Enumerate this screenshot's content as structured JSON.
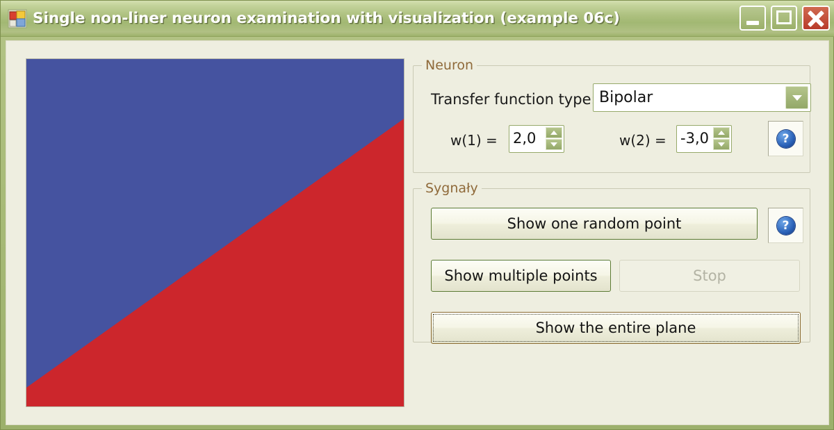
{
  "window": {
    "title": "Single non-liner neuron examination with visualization (example 06c)",
    "app_icon": "form-icon",
    "controls": {
      "minimize_label": "Minimize",
      "maximize_label": "Maximize",
      "close_label": "Close"
    }
  },
  "colors": {
    "titlebar": "#a8bb78",
    "client": "#eeeee0",
    "group_label": "#8f6a3a",
    "plot_blue": "#4553a0",
    "plot_red": "#cc262c",
    "button_border": "#5b7a33",
    "focus_border": "#8a6a30",
    "help_icon": "#2a62b8"
  },
  "plot": {
    "name": "decision-plane-visualization",
    "blue_color": "#4553a0",
    "red_color": "#cc262c",
    "boundary": {
      "left_y_fraction": 0.946,
      "right_y_fraction": 0.172
    },
    "regions": [
      {
        "label": "positive-region",
        "color": "#4553a0",
        "position": "upper-left"
      },
      {
        "label": "negative-region",
        "color": "#cc262c",
        "position": "lower-right"
      }
    ]
  },
  "neuron_group": {
    "legend": "Neuron",
    "transfer_label": "Transfer function type:",
    "transfer_value": "Bipolar",
    "transfer_options": [
      "Bipolar"
    ],
    "w1_label": "w(1) =",
    "w1_value": "2,0",
    "w2_label": "w(2) =",
    "w2_value": "-3,0",
    "help_label": "?"
  },
  "signals_group": {
    "legend": "Sygnały",
    "btn_random": "Show one random point",
    "btn_multiple": "Show multiple points",
    "btn_stop": "Stop",
    "btn_plane": "Show the entire plane",
    "help_label": "?"
  }
}
